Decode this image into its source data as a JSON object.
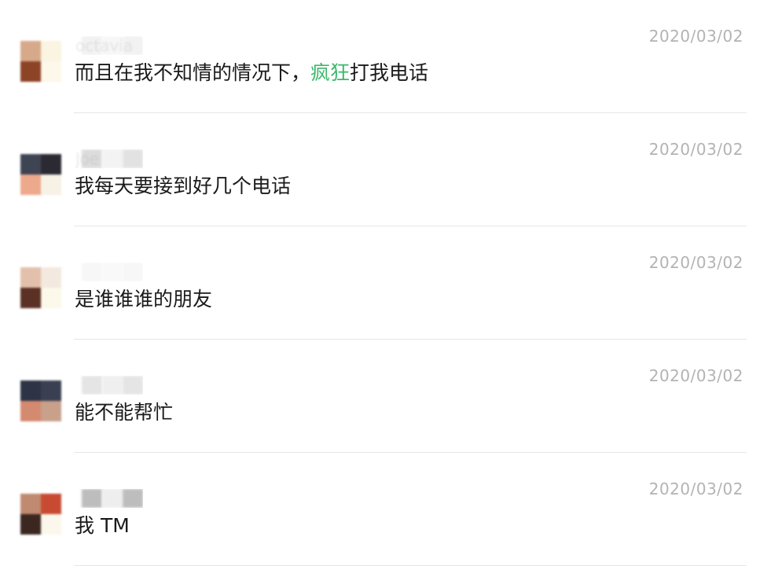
{
  "comments": [
    {
      "name": "octavia",
      "date": "2020/03/02",
      "message_before": "而且在我不知情的情况下，",
      "message_highlight": "疯狂",
      "message_after": "打我电话",
      "avatar_colors": [
        "#d7a98b",
        "#fbf4e1",
        "#8d4326",
        "#fdf8ea"
      ],
      "name_colors": [
        "#f2f2f2",
        "#f7f7f7",
        "#f2f2f2"
      ]
    },
    {
      "name": "Joe",
      "date": "2020/03/02",
      "message_before": "我每天要接到好几个电话",
      "message_highlight": "",
      "message_after": "",
      "avatar_colors": [
        "#3f4453",
        "#2b2a33",
        "#eda98c",
        "#f7f1e6"
      ],
      "name_colors": [
        "#dcdcdc",
        "#f3f3f3",
        "#e2e2e2"
      ]
    },
    {
      "name": "",
      "date": "2020/03/02",
      "message_before": "是谁谁谁的朋友",
      "message_highlight": "",
      "message_after": "",
      "avatar_colors": [
        "#e3c0ac",
        "#f3e9de",
        "#5b3125",
        "#fcf8ea"
      ],
      "name_colors": [
        "#f7f7f7",
        "#f9f9f9",
        "#f7f7f7"
      ]
    },
    {
      "name": "",
      "date": "2020/03/02",
      "message_before": "能不能帮忙",
      "message_highlight": "",
      "message_after": "",
      "avatar_colors": [
        "#2e3445",
        "#3a3f52",
        "#d48a6f",
        "#c9a08a"
      ],
      "name_colors": [
        "#e5e5e5",
        "#efefef",
        "#e5e5e5"
      ]
    },
    {
      "name": "",
      "date": "2020/03/02",
      "message_before": "我 TM",
      "message_highlight": "",
      "message_after": "",
      "avatar_colors": [
        "#c08a70",
        "#c84a32",
        "#3b2720",
        "#fbf7ec"
      ],
      "name_colors": [
        "#bdbdbd",
        "#eeeeee",
        "#bdbdbd"
      ]
    }
  ]
}
